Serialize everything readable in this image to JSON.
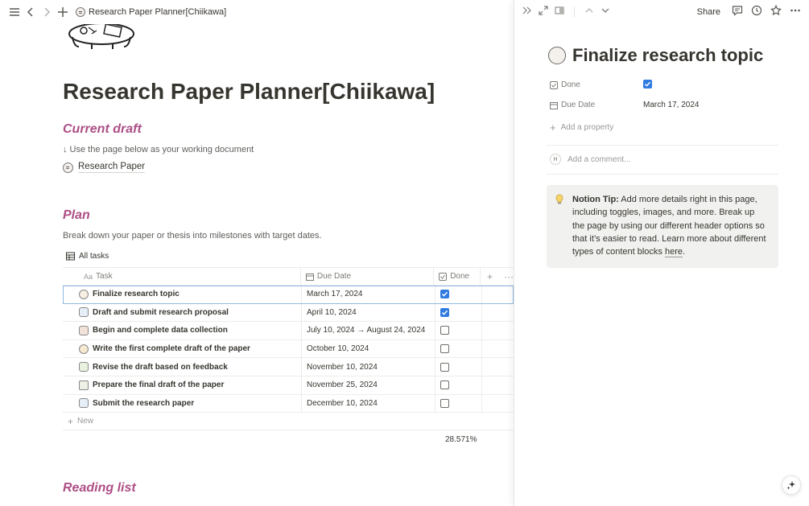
{
  "topbar": {
    "breadcrumb": "Research Paper Planner[Chiikawa]"
  },
  "page": {
    "title": "Research Paper Planner[Chiikawa]",
    "current_draft": {
      "heading": "Current draft",
      "hint": "↓ Use the page below as your working document",
      "link_label": "Research Paper"
    },
    "plan": {
      "heading": "Plan",
      "description": "Break down your paper or thesis into milestones with target dates.",
      "view_label": "All tasks",
      "columns": {
        "task": "Task",
        "task_prefix": "Aa",
        "due": "Due Date",
        "done": "Done"
      },
      "rows": [
        {
          "task": "Finalize research topic",
          "due": "March 17, 2024",
          "done": true
        },
        {
          "task": "Draft and submit research proposal",
          "due": "April 10, 2024",
          "done": true
        },
        {
          "task": "Begin and complete data collection",
          "due": "July 10, 2024 → August 24, 2024",
          "done": false
        },
        {
          "task": "Write the first complete draft of the paper",
          "due": "October 10, 2024",
          "done": false
        },
        {
          "task": "Revise the draft based on feedback",
          "due": "November 10, 2024",
          "done": false
        },
        {
          "task": "Prepare the final draft of the paper",
          "due": "November 25, 2024",
          "done": false
        },
        {
          "task": "Submit the research paper",
          "due": "December 10, 2024",
          "done": false
        }
      ],
      "new_label": "New",
      "calculation": "28.571%"
    },
    "reading_list": {
      "heading": "Reading list"
    }
  },
  "peek": {
    "share_label": "Share",
    "title": "Finalize research topic",
    "props": {
      "done_label": "Done",
      "done_value": true,
      "due_label": "Due Date",
      "due_value": "March 17, 2024"
    },
    "add_property": "Add a property",
    "comment_avatar": "H",
    "comment_placeholder": "Add a comment...",
    "tip": {
      "bold": "Notion Tip:",
      "text": " Add more details right in this page, including toggles, images, and more. Break up the page by using our different header options so that it’s easier to read. Learn more about different types of content blocks ",
      "link": "here",
      "end": "."
    }
  },
  "colors": {
    "accent_heading": "#ad4e86",
    "checkbox_on": "#2f7be0",
    "selection": "#90b8e3"
  },
  "icons": [
    "menu-icon",
    "back-icon",
    "forward-icon",
    "plus-icon",
    "table-icon",
    "calendar-icon",
    "checkbox-icon",
    "comment-icon",
    "clock-icon",
    "star-icon",
    "more-icon",
    "bulb-icon",
    "sparkle-icon"
  ]
}
